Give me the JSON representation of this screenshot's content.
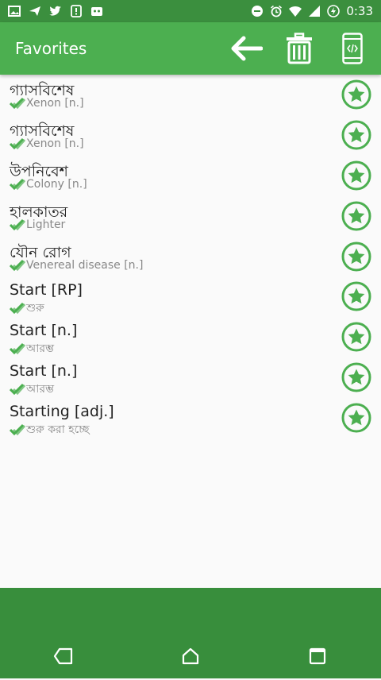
{
  "statusbar": {
    "time": "0:33",
    "left_icons": [
      "image-icon",
      "send-icon",
      "twitter-icon",
      "alert-icon",
      "android-icon"
    ],
    "right_icons": [
      "dnd-icon",
      "alarm-icon",
      "wifi-icon",
      "signal-icon",
      "battery-icon"
    ]
  },
  "appbar": {
    "title": "Favorites",
    "actions": [
      "back-arrow-icon",
      "trash-icon",
      "phone-code-icon"
    ]
  },
  "favorites": [
    {
      "word": "গ্যাসবিশেষ",
      "meaning": "Xenon [n.]"
    },
    {
      "word": "গ্যাসবিশেষ",
      "meaning": "Xenon [n.]"
    },
    {
      "word": "উপনিবেশ",
      "meaning": "Colony [n.]"
    },
    {
      "word": "হালকাতর",
      "meaning": "Lighter"
    },
    {
      "word": "যৌন রোগ",
      "meaning": "Venereal disease [n.]"
    },
    {
      "word": "Start [RP]",
      "meaning": "শুরু"
    },
    {
      "word": "Start [n.]",
      "meaning": "আরম্ভ"
    },
    {
      "word": "Start [n.]",
      "meaning": "আরম্ভ"
    },
    {
      "word": "Starting [adj.]",
      "meaning": "শুরু করা হচ্ছে"
    }
  ],
  "navbar": [
    "back-nav-icon",
    "home-nav-icon",
    "recents-nav-icon"
  ],
  "colors": {
    "statusbar": "#3b8f3e",
    "appbar": "#4caf50",
    "navbar": "#388e3c",
    "star": "#4caf50"
  }
}
